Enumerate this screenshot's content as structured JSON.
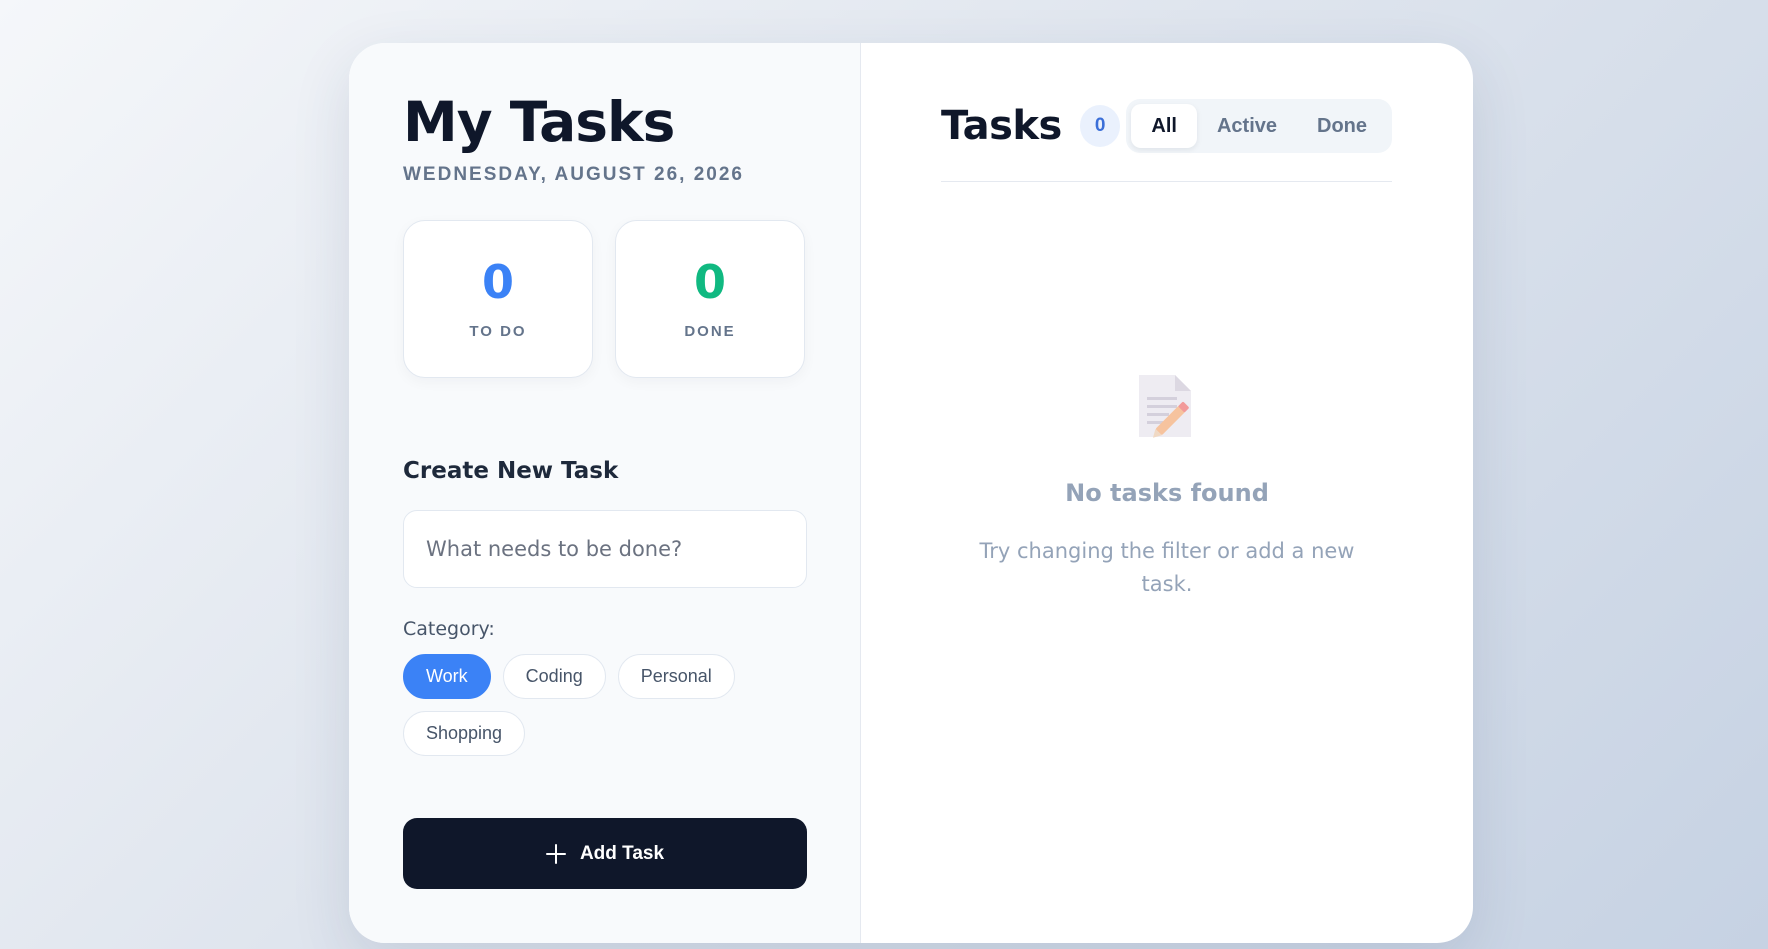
{
  "app": {
    "title": "My Tasks",
    "date": "WEDNESDAY, AUGUST 26, 2026"
  },
  "stats": [
    {
      "value": "0",
      "label": "TO DO",
      "color": "#3b82f6"
    },
    {
      "value": "0",
      "label": "DONE",
      "color": "#10b981"
    }
  ],
  "create": {
    "title": "Create New Task",
    "input_placeholder": "What needs to be done?",
    "input_value": "",
    "category_label": "Category:",
    "categories": [
      "Work",
      "Coding",
      "Personal",
      "Shopping"
    ],
    "selected_category": "Work",
    "add_button_label": "Add Task",
    "add_icon": "plus-icon"
  },
  "tasks": {
    "title": "Tasks",
    "count": "0",
    "filters": [
      "All",
      "Active",
      "Done"
    ],
    "active_filter": "All",
    "empty_icon": "memo-icon",
    "empty_title": "No tasks found",
    "empty_text": "Try changing the filter or add a new task."
  },
  "colors": {
    "accent": "#3b82f6",
    "done": "#10b981",
    "dark": "#0f172a"
  }
}
